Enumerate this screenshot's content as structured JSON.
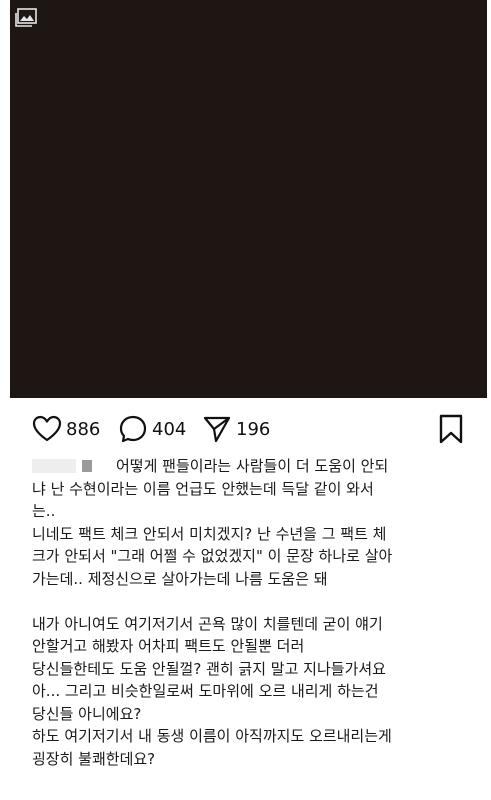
{
  "post": {
    "likes": "886",
    "comments": "404",
    "shares": "196"
  },
  "icons": {
    "media": "image-gallery-icon",
    "like": "heart-icon",
    "comment": "comment-bubble-icon",
    "share": "send-icon",
    "save": "bookmark-icon"
  },
  "colors": {
    "media_background": "#1d1613"
  },
  "caption": {
    "lines": [
      "어떻게 팬들이라는 사람들이 더 도움이 안되",
      "냐 난 수현이라는 이름 언급도 안했는데 득달 같이 와서",
      "는..",
      "니네도 팩트 체크 안되서 미치겠지? 난 수년을 그 팩트 체",
      "크가 안되서 \"그래 어쩔 수 없었겠지\" 이 문장 하나로 살아",
      "가는데.. 제정신으로 살아가는데 나름 도움은 돼",
      "",
      "내가 아니여도 여기저기서 곤욕 많이 치를텐데 굳이 얘기",
      "안할거고 해봤자 어차피 팩트도 안될뿐 더러",
      "당신들한테도 도움 안될껄? 괜히 긁지 말고 지나들가셔요",
      "아... 그리고 비슷한일로써 도마위에 오르 내리게 하는건",
      "당신들 아니에요?",
      "하도 여기저기서 내 동생 이름이 아직까지도 오르내리는게",
      "굉장히 불쾌한데요?"
    ]
  }
}
